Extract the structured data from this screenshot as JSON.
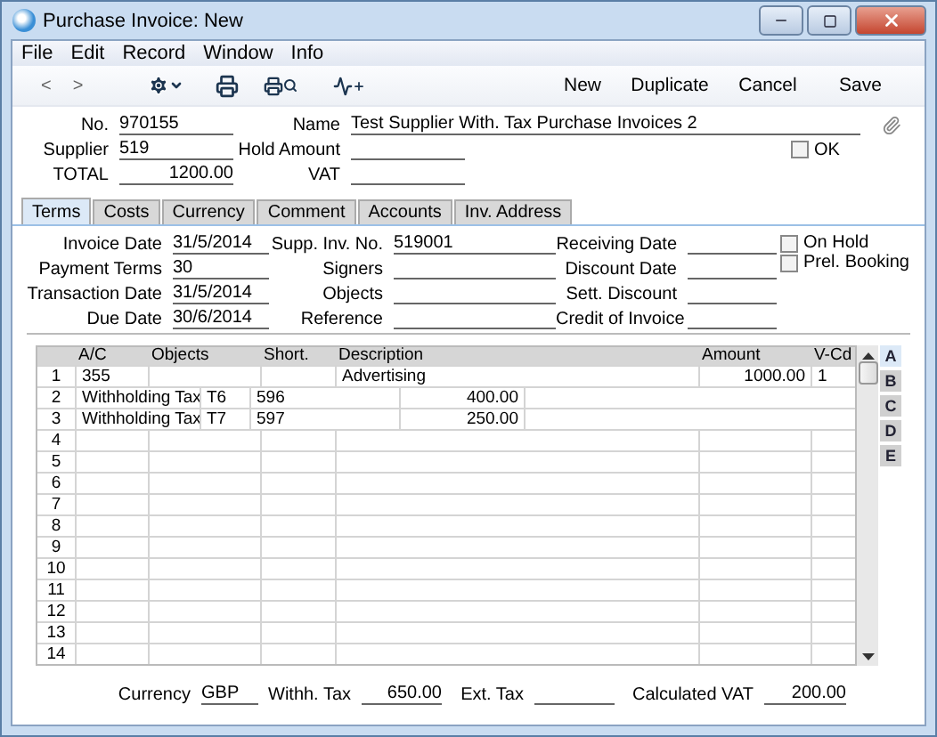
{
  "window": {
    "title": "Purchase Invoice: New"
  },
  "menu": [
    "File",
    "Edit",
    "Record",
    "Window",
    "Info"
  ],
  "toolbar": {
    "nav": [
      "<",
      ">"
    ],
    "actions": [
      "New",
      "Duplicate",
      "Cancel",
      "Save"
    ]
  },
  "header": {
    "fields": [
      {
        "label": "No.",
        "value": "970155"
      },
      {
        "label": "Name",
        "value": "Test Supplier With. Tax Purchase Invoices 2"
      },
      {
        "label": "Supplier",
        "value": "519"
      },
      {
        "label": "Hold Amount"
      },
      {
        "label": "TOTAL",
        "value": "1200.00"
      },
      {
        "label": "VAT"
      }
    ],
    "ok": {
      "label": "OK",
      "checked": false
    }
  },
  "tabs": [
    {
      "label": "Terms",
      "selected": true
    },
    {
      "label": "Costs",
      "selected": false
    },
    {
      "label": "Currency",
      "selected": false
    },
    {
      "label": "Comment",
      "selected": false
    },
    {
      "label": "Accounts",
      "selected": false
    },
    {
      "label": "Inv. Address",
      "selected": false
    }
  ],
  "terms": {
    "columns": [
      [
        {
          "label": "Invoice Date",
          "value": "31/5/2014"
        },
        {
          "label": "Payment Terms",
          "value": "30"
        },
        {
          "label": "Transaction Date",
          "value": "31/5/2014"
        },
        {
          "label": "Due Date",
          "value": "30/6/2014"
        }
      ],
      [
        {
          "label": "Supp. Inv. No.",
          "value": "519001"
        },
        {
          "label": "Signers"
        },
        {
          "label": "Objects"
        },
        {
          "label": "Reference"
        }
      ],
      [
        {
          "label": "Receiving Date"
        },
        {
          "label": "Discount Date"
        },
        {
          "label": "Sett. Discount"
        },
        {
          "label": "Credit of Invoice"
        }
      ]
    ],
    "checkboxes": [
      {
        "label": "On Hold",
        "checked": false
      },
      {
        "label": "Prel. Booking",
        "checked": false
      }
    ]
  },
  "grid": {
    "columns": [
      "A/C",
      "Objects",
      "Short.",
      "Description",
      "Amount",
      "V-Cd"
    ],
    "rows": [
      {
        "number": "1",
        "kind": "line",
        "cells": [
          "355",
          "",
          "",
          "Advertising",
          "1000.00",
          "1"
        ]
      },
      {
        "number": "2",
        "kind": "tax",
        "tax_name": "Withholding Tax",
        "tax_code": "T6",
        "account": "596",
        "amount": "400.00"
      },
      {
        "number": "3",
        "kind": "tax",
        "tax_name": "Withholding Tax",
        "tax_code": "T7",
        "account": "597",
        "amount": "250.00"
      },
      {
        "number": "4",
        "kind": "line",
        "cells": [
          "",
          "",
          "",
          "",
          "",
          ""
        ]
      },
      {
        "number": "5",
        "kind": "line",
        "cells": [
          "",
          "",
          "",
          "",
          "",
          ""
        ]
      },
      {
        "number": "6",
        "kind": "line",
        "cells": [
          "",
          "",
          "",
          "",
          "",
          ""
        ]
      },
      {
        "number": "7",
        "kind": "line",
        "cells": [
          "",
          "",
          "",
          "",
          "",
          ""
        ]
      },
      {
        "number": "8",
        "kind": "line",
        "cells": [
          "",
          "",
          "",
          "",
          "",
          ""
        ]
      },
      {
        "number": "9",
        "kind": "line",
        "cells": [
          "",
          "",
          "",
          "",
          "",
          ""
        ]
      },
      {
        "number": "10",
        "kind": "line",
        "cells": [
          "",
          "",
          "",
          "",
          "",
          ""
        ]
      },
      {
        "number": "11",
        "kind": "line",
        "cells": [
          "",
          "",
          "",
          "",
          "",
          ""
        ]
      },
      {
        "number": "12",
        "kind": "line",
        "cells": [
          "",
          "",
          "",
          "",
          "",
          ""
        ]
      },
      {
        "number": "13",
        "kind": "line",
        "cells": [
          "",
          "",
          "",
          "",
          "",
          ""
        ]
      },
      {
        "number": "14",
        "kind": "line",
        "cells": [
          "",
          "",
          "",
          "",
          "",
          ""
        ]
      }
    ],
    "side_tabs": [
      {
        "label": "A",
        "selected": true
      },
      {
        "label": "B",
        "selected": false
      },
      {
        "label": "C",
        "selected": false
      },
      {
        "label": "D",
        "selected": false
      },
      {
        "label": "E",
        "selected": false
      }
    ]
  },
  "footer": [
    {
      "label": "Currency",
      "value": "GBP"
    },
    {
      "label": "Withh. Tax",
      "value": "650.00"
    },
    {
      "label": "Ext. Tax"
    },
    {
      "label": "Calculated VAT",
      "value": "200.00"
    }
  ]
}
